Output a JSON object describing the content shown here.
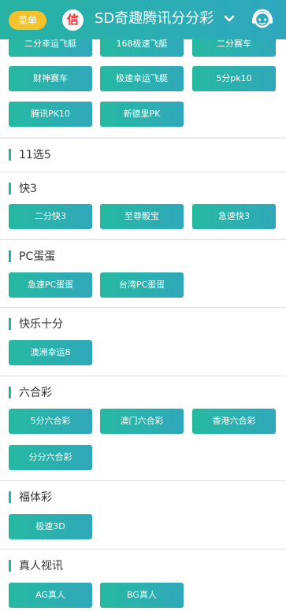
{
  "header": {
    "menu_label": "菜单",
    "xin_label": "信",
    "title": "SD奇趣腾讯分分彩",
    "icons": [
      "chevron-down-icon",
      "customer-service-icon"
    ],
    "accent_color": "#27b3a3",
    "menu_color": "#f6c22c"
  },
  "sections": {
    "pk10": {
      "buttons": [
        "二分幸运飞艇",
        "168极速飞艇",
        "二分赛车",
        "财神赛车",
        "极速幸运飞艇",
        "5分pk10",
        "腾讯PK10",
        "新德里PK"
      ]
    },
    "s11x5": {
      "title": "11选5"
    },
    "k3": {
      "title": "快3",
      "buttons": [
        "二分快3",
        "至尊骰宝",
        "急速快3"
      ]
    },
    "pcdd": {
      "title": "PC蛋蛋",
      "buttons": [
        "急速PC蛋蛋",
        "台湾PC蛋蛋"
      ]
    },
    "klsf": {
      "title": "快乐十分",
      "buttons": [
        "澳洲幸运8"
      ]
    },
    "lhc": {
      "title": "六合彩",
      "buttons": [
        "5分六合彩",
        "澳门六合彩",
        "香港六合彩",
        "分分六合彩"
      ]
    },
    "fc": {
      "title": "福体彩",
      "buttons": [
        "极速3D"
      ]
    },
    "live": {
      "title": "真人视讯",
      "buttons": [
        "AG真人",
        "BG真人"
      ]
    }
  }
}
